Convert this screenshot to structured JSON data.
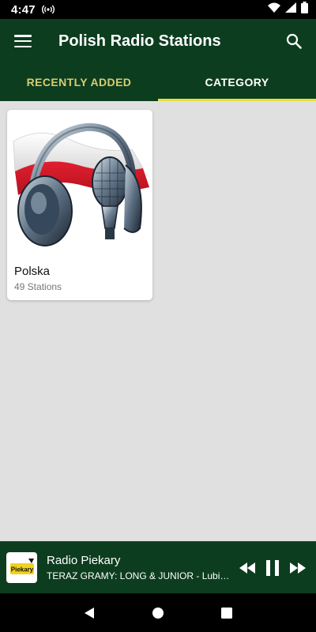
{
  "status_bar": {
    "time": "4:47",
    "icons": [
      "radio-signal-icon",
      "wifi-icon",
      "cell-signal-icon",
      "battery-icon"
    ]
  },
  "header": {
    "title": "Polish Radio Stations",
    "menu_icon": "hamburger-menu-icon",
    "search_icon": "search-icon",
    "colors": {
      "background": "#0d3d1f",
      "inactive_tab": "#d6cd74",
      "indicator": "#e6df3e"
    }
  },
  "tabs": [
    {
      "label": "RECENTLY ADDED",
      "active": false
    },
    {
      "label": "CATEGORY",
      "active": true
    }
  ],
  "categories": [
    {
      "name": "Polska",
      "count": "49 Stations",
      "image": "polish-flag-headphones-microphone"
    }
  ],
  "player": {
    "station": "Radio Piekary",
    "now_playing": "TERAZ GRAMY: LONG & JUNIOR - Lubie to...",
    "logo_text": "Piekary",
    "controls": [
      "rewind-icon",
      "pause-icon",
      "fast-forward-icon"
    ]
  },
  "nav_bar": {
    "buttons": [
      "back-icon",
      "home-icon",
      "recents-icon"
    ]
  }
}
